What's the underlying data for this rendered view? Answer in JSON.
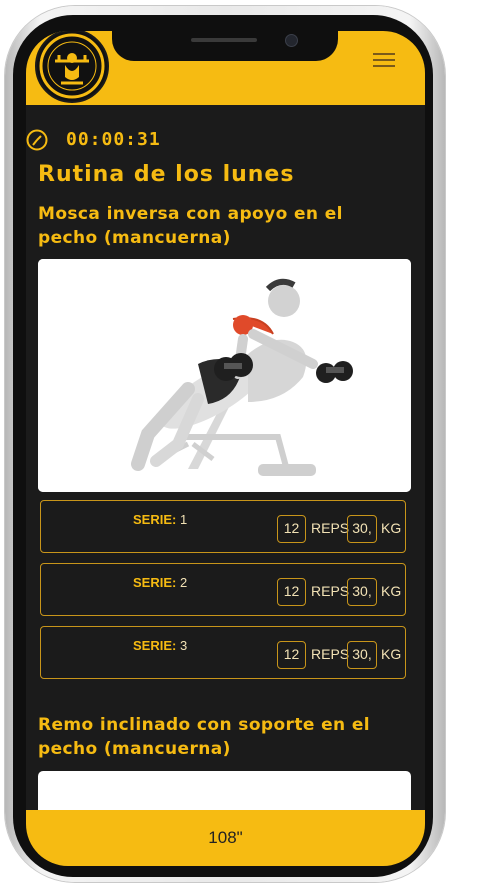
{
  "header": {
    "menu_icon": "hamburger-icon",
    "logo_icon": "gym-logo-icon"
  },
  "timer": {
    "icon": "clock-icon",
    "value": "00:00:31"
  },
  "routine": {
    "title": "Rutina de los lunes"
  },
  "exercises": [
    {
      "title": "Mosca inversa con apoyo en el pecho (mancuerna)",
      "image_icon": "exercise-illustration-icon",
      "series": [
        {
          "label": "SERIE:",
          "number": "1",
          "reps": "12",
          "reps_unit": "REPS",
          "weight": "30,",
          "weight_unit": "KG"
        },
        {
          "label": "SERIE:",
          "number": "2",
          "reps": "12",
          "reps_unit": "REPS",
          "weight": "30,",
          "weight_unit": "KG"
        },
        {
          "label": "SERIE:",
          "number": "3",
          "reps": "12",
          "reps_unit": "REPS",
          "weight": "30,",
          "weight_unit": "KG"
        }
      ]
    },
    {
      "title": "Remo inclinado con soporte en el pecho (mancuerna)",
      "image_icon": "exercise-illustration-icon"
    }
  ],
  "footer": {
    "text": "108\""
  },
  "colors": {
    "accent": "#f6bb12",
    "background": "#1b1b1b",
    "border": "#c8951a"
  }
}
